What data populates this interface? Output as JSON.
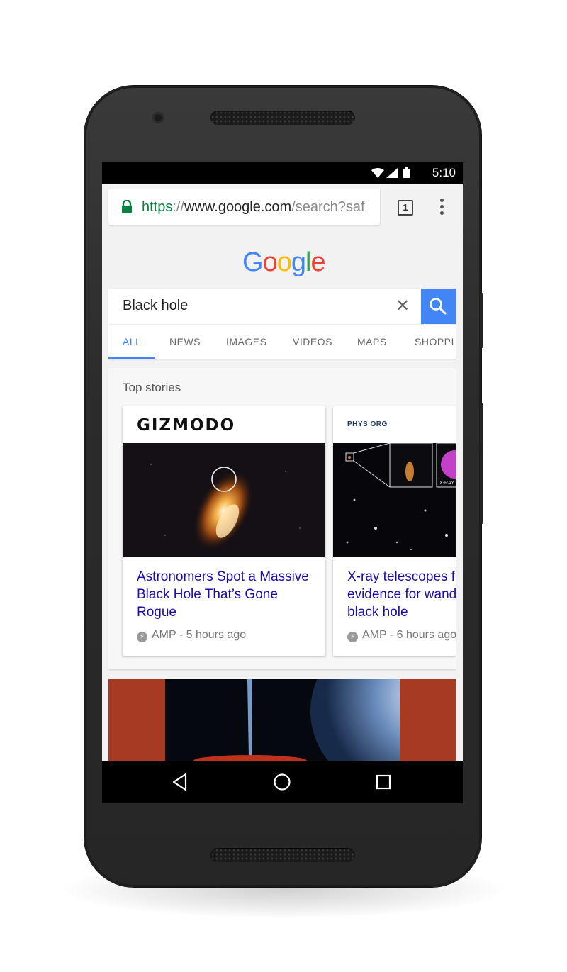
{
  "status_bar": {
    "time": "5:10"
  },
  "browser": {
    "url_scheme": "https",
    "url_sep": "://",
    "url_host": "www.google.com",
    "url_path": "/search?saf",
    "tab_count": "1"
  },
  "logo": {
    "text": "Google"
  },
  "search": {
    "query": "Black hole"
  },
  "tabs": [
    {
      "label": "ALL"
    },
    {
      "label": "NEWS"
    },
    {
      "label": "IMAGES"
    },
    {
      "label": "VIDEOS"
    },
    {
      "label": "MAPS"
    },
    {
      "label": "SHOPPI"
    }
  ],
  "top_stories": {
    "title": "Top stories",
    "cards": [
      {
        "publisher": "GIZMODO",
        "headline": "Astronomers Spot a Massive Black Hole That’s Gone Rogue",
        "meta": "AMP - 5 hours ago"
      },
      {
        "publisher": "PHYS ORG",
        "headline": "X-ray telescopes fi evidence for wande black hole",
        "meta": "AMP - 6 hours ago",
        "image_label": "X-RAY"
      }
    ]
  },
  "colors": {
    "accent": "#4285f4",
    "link": "#1a0dab",
    "secure": "#0b8043",
    "bottom_card": "#a63a22"
  }
}
